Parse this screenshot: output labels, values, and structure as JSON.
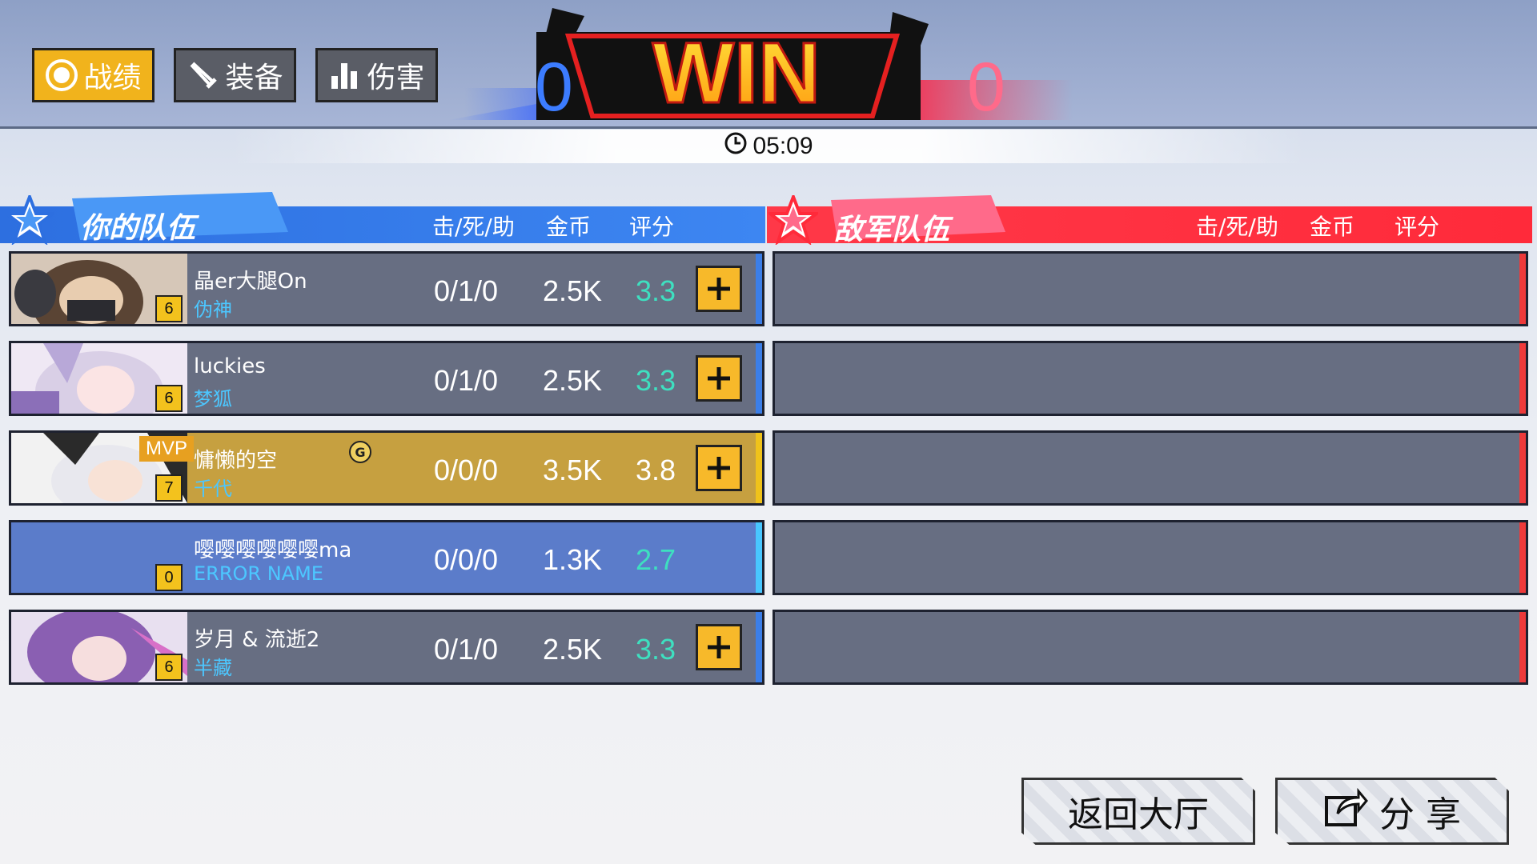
{
  "tabs": [
    {
      "label": "战绩",
      "icon": "target-icon",
      "active": true
    },
    {
      "label": "装备",
      "icon": "sword-icon",
      "active": false
    },
    {
      "label": "伤害",
      "icon": "bar-chart-icon",
      "active": false
    }
  ],
  "banner": {
    "text": "WIN",
    "score_left": "0",
    "score_right": "0"
  },
  "timer": {
    "icon": "clock-icon",
    "value": "05:09"
  },
  "your_team": {
    "title": "你的队伍",
    "columns": {
      "kda": "击/死/助",
      "gold": "金币",
      "rating": "评分"
    },
    "players": [
      {
        "name": "晶er大腿On",
        "hero": "伪神",
        "level": "6",
        "kda": "0/1/0",
        "gold": "2.5K",
        "rating": "3.3"
      },
      {
        "name": "luckies",
        "hero": "梦狐",
        "level": "6",
        "kda": "0/1/0",
        "gold": "2.5K",
        "rating": "3.3"
      },
      {
        "name": "慵懒的空",
        "hero": "千代",
        "level": "7",
        "kda": "0/0/0",
        "gold": "3.5K",
        "rating": "3.8",
        "mvp": "MVP",
        "badge": "G"
      },
      {
        "name": "嘤嘤嘤嘤嘤嘤ma",
        "hero": "ERROR NAME",
        "level": "0",
        "kda": "0/0/0",
        "gold": "1.3K",
        "rating": "2.7"
      },
      {
        "name": "岁月 & 流逝2",
        "hero": "半藏",
        "level": "6",
        "kda": "0/1/0",
        "gold": "2.5K",
        "rating": "3.3"
      }
    ]
  },
  "enemy_team": {
    "title": "敌军队伍",
    "columns": {
      "kda": "击/死/助",
      "gold": "金币",
      "rating": "评分"
    }
  },
  "buttons": {
    "return_lobby": "返回大厅",
    "share": "分 享"
  },
  "colors": {
    "accent_yellow": "#f1b31c",
    "team_blue": "#3b7ee8",
    "enemy_red": "#ee3a3a",
    "rating_teal": "#3ee0c0",
    "hero_blue": "#4cc7ff"
  }
}
